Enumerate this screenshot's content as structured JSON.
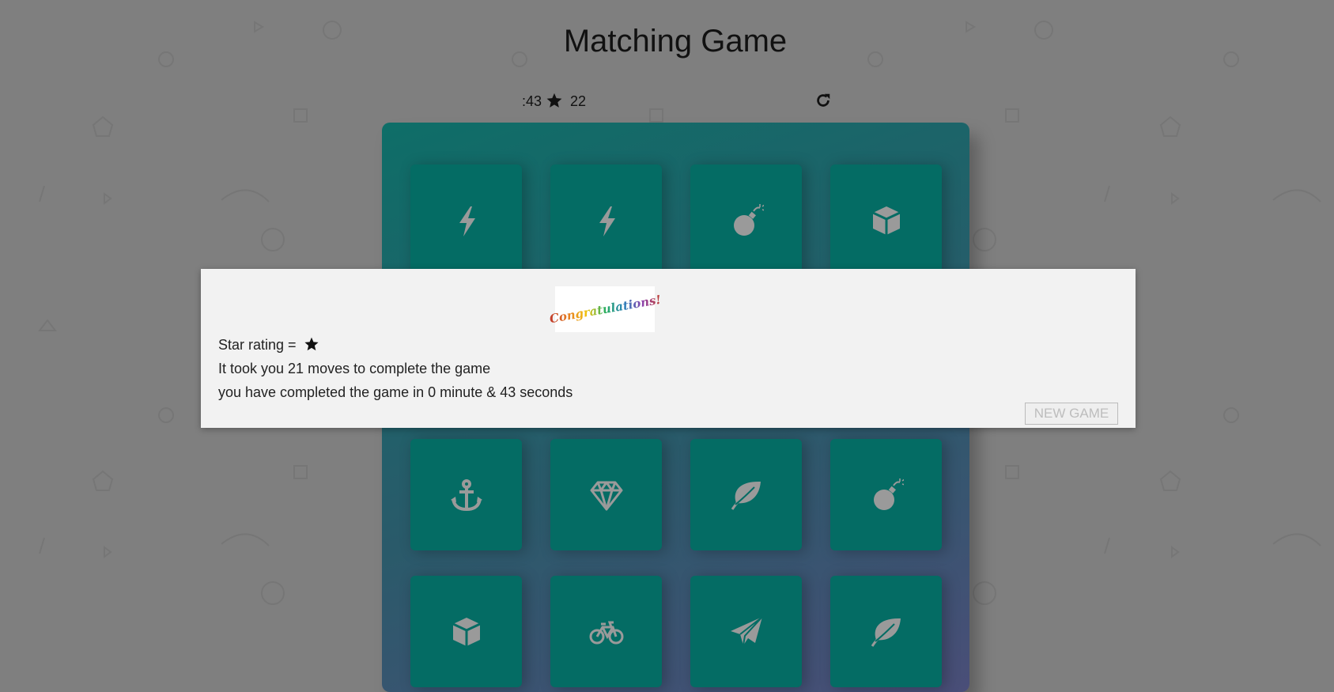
{
  "header": {
    "title": "Matching Game"
  },
  "score_panel": {
    "timer": ":43",
    "moves": "22",
    "star_icon": "star-icon",
    "restart_icon": "restart-icon"
  },
  "deck": {
    "cards": [
      {
        "icon": "bolt-icon"
      },
      {
        "icon": "bolt-icon"
      },
      {
        "icon": "bomb-icon"
      },
      {
        "icon": "cube-icon"
      },
      {
        "icon": "hidden"
      },
      {
        "icon": "hidden"
      },
      {
        "icon": "hidden"
      },
      {
        "icon": "hidden"
      },
      {
        "icon": "anchor-icon"
      },
      {
        "icon": "diamond-icon"
      },
      {
        "icon": "leaf-icon"
      },
      {
        "icon": "bomb-icon"
      },
      {
        "icon": "cube-icon"
      },
      {
        "icon": "bicycle-icon"
      },
      {
        "icon": "paper-plane-icon"
      },
      {
        "icon": "leaf-icon"
      }
    ]
  },
  "modal": {
    "banner_text": "Congratulations!",
    "rating_label": "Star rating =",
    "moves_text": "It took you 21 moves to complete the game",
    "time_text": "you have completed the game in 0 minute & 43 seconds",
    "new_game_label": "NEW GAME"
  },
  "colors": {
    "page_background": "#7f7f7f",
    "card": "#046c64",
    "card_icon": "#9a9a9a",
    "modal_background": "#f2f2f2"
  }
}
